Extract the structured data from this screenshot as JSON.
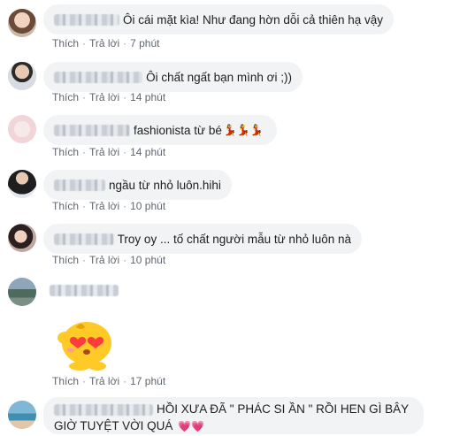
{
  "actions": {
    "like": "Thích",
    "reply": "Trả lời",
    "sep": "·"
  },
  "comments": [
    {
      "text": "Ôi cái mặt kìa! Như đang hờn dỗi cả thiên hạ vậy",
      "time": "7 phút"
    },
    {
      "text": "Ôi chất ngất bạn mình ơi ;))",
      "time": "14 phút"
    },
    {
      "text": "fashionista từ bé",
      "time": "14 phút",
      "emoji": "💃💃💃"
    },
    {
      "text": "ngầu từ nhỏ luôn.hihi",
      "time": "10 phút"
    },
    {
      "text": "Troy oy ... tố chất người mẫu từ nhỏ luôn nà",
      "time": "10 phút"
    },
    {
      "text": "",
      "time": "17 phút",
      "sticker": "heart-eyes-chick"
    },
    {
      "text": "HỒI XƯA ĐÃ \" PHÁC SI ẦN \" RỒI HEN GÌ BÂY GIỜ TUYỆT VỜI QUÁ",
      "emoji": "💗💗"
    }
  ],
  "colors": {
    "bubble": "#f2f3f5",
    "meta": "#606770",
    "heart": "#e0245e"
  }
}
